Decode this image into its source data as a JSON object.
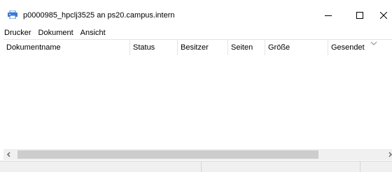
{
  "window": {
    "title": "p0000985_hpclj3525 an ps20.campus.intern",
    "controls": {
      "minimize": "minimize",
      "maximize": "maximize",
      "close": "close"
    }
  },
  "menu": [
    "Drucker",
    "Dokument",
    "Ansicht"
  ],
  "columns": [
    "Dokumentname",
    "Status",
    "Besitzer",
    "Seiten",
    "Größe",
    "Gesendet"
  ],
  "rows": [],
  "icons": {
    "app": "printer-icon",
    "sort": "chevron-down-icon",
    "scroll_left": "chevron-left-icon",
    "scroll_right": "chevron-right-icon"
  },
  "colors": {
    "window_bg": "#ffffff",
    "scrollbar_track": "#f0f0f0",
    "scrollbar_thumb": "#cdcdcd",
    "statusbar_bg": "#f0f0f0"
  }
}
